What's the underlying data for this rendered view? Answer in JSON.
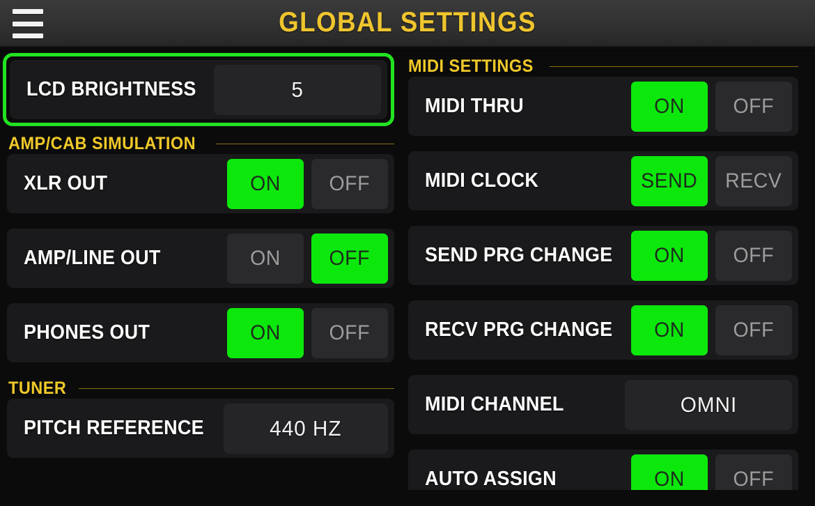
{
  "header": {
    "title": "GLOBAL SETTINGS",
    "menu_icon": "hamburger-menu-icon",
    "title_color": "#efc52e",
    "background_color": "#333333"
  },
  "theme": {
    "accent_green": "#0ce80c",
    "selection_border": "#22e222",
    "section_yellow": "#f0c929",
    "card_background": "#1a1a1c",
    "value_background": "#252528",
    "page_background": "#0b0b0b",
    "label_color": "#ffffff",
    "inactive_text": "#9d9d9d"
  },
  "selected_row": {
    "label": "LCD BRIGHTNESS",
    "value": "5",
    "is_selected": true
  },
  "left_column": {
    "sections": [
      {
        "title": "AMP/CAB SIMULATION",
        "rows": [
          {
            "label": "XLR OUT",
            "type": "toggle",
            "options": [
              "ON",
              "OFF"
            ],
            "active": "ON"
          },
          {
            "label": "AMP/LINE OUT",
            "type": "toggle",
            "options": [
              "ON",
              "OFF"
            ],
            "active": "OFF"
          },
          {
            "label": "PHONES OUT",
            "type": "toggle",
            "options": [
              "ON",
              "OFF"
            ],
            "active": "ON"
          }
        ]
      },
      {
        "title": "TUNER",
        "rows": [
          {
            "label": "PITCH REFERENCE",
            "type": "value",
            "value": "440 HZ"
          }
        ]
      }
    ]
  },
  "right_column": {
    "sections": [
      {
        "title": "MIDI SETTINGS",
        "rows": [
          {
            "label": "MIDI THRU",
            "type": "toggle",
            "options": [
              "ON",
              "OFF"
            ],
            "active": "ON"
          },
          {
            "label": "MIDI CLOCK",
            "type": "toggle",
            "options": [
              "SEND",
              "RECV"
            ],
            "active": "SEND"
          },
          {
            "label": "SEND PRG CHANGE",
            "type": "toggle",
            "options": [
              "ON",
              "OFF"
            ],
            "active": "ON"
          },
          {
            "label": "RECV PRG CHANGE",
            "type": "toggle",
            "options": [
              "ON",
              "OFF"
            ],
            "active": "ON"
          },
          {
            "label": "MIDI CHANNEL",
            "type": "value",
            "value": "OMNI"
          },
          {
            "label": "AUTO ASSIGN",
            "type": "toggle",
            "options": [
              "ON",
              "OFF"
            ],
            "active": "ON"
          }
        ]
      }
    ]
  }
}
